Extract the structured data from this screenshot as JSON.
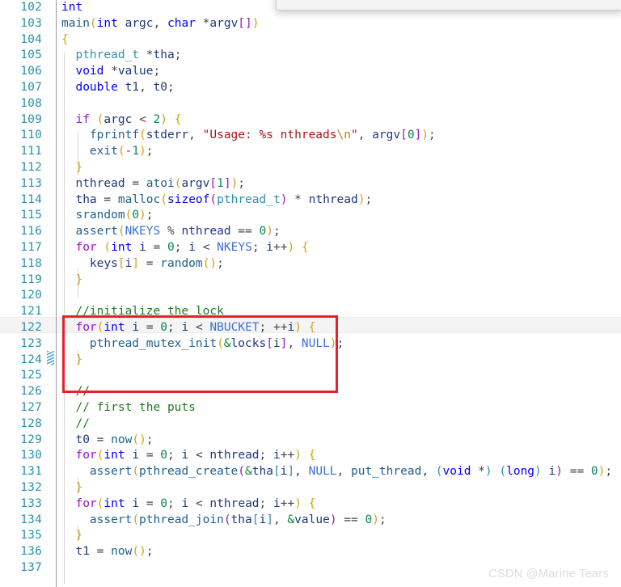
{
  "app": {
    "kind": "code-editor",
    "language": "C",
    "watermark": "CSDN @Marine Tears"
  },
  "popup": {
    "present": true,
    "label": ""
  },
  "gutter": {
    "first_line": 102,
    "last_line": 137,
    "change_marker_line": 123
  },
  "annotation": {
    "type": "red-rectangle",
    "covers_lines": [
      121,
      122,
      123,
      124
    ],
    "color": "#e8202a"
  },
  "highlight": {
    "current_line": 121,
    "color": "#f4f4f4"
  },
  "colors": {
    "line_number": "#2b91af",
    "keyword_control": "#9b17c4",
    "keyword_type": "#0000ff",
    "type_name": "#2b91af",
    "identifier": "#1f377f",
    "function": "#1f5f8f",
    "macro": "#3d6fd6",
    "number": "#098658",
    "string": "#a31515",
    "comment": "#1f7a1f",
    "bracket_gold": "#d4a017",
    "watermark": "#dcdcdc"
  },
  "code": {
    "lines": [
      {
        "n": 102,
        "text": "int"
      },
      {
        "n": 103,
        "text": "main(int argc, char *argv[])"
      },
      {
        "n": 104,
        "text": "{"
      },
      {
        "n": 105,
        "text": "  pthread_t *tha;"
      },
      {
        "n": 106,
        "text": "  void *value;"
      },
      {
        "n": 107,
        "text": "  double t1, t0;"
      },
      {
        "n": 108,
        "text": ""
      },
      {
        "n": 109,
        "text": "  if (argc < 2) {"
      },
      {
        "n": 110,
        "text": "    fprintf(stderr, \"Usage: %s nthreads\\n\", argv[0]);"
      },
      {
        "n": 111,
        "text": "    exit(-1);"
      },
      {
        "n": 112,
        "text": "  }"
      },
      {
        "n": 113,
        "text": "  nthread = atoi(argv[1]);"
      },
      {
        "n": 114,
        "text": "  tha = malloc(sizeof(pthread_t) * nthread);"
      },
      {
        "n": 115,
        "text": "  srandom(0);"
      },
      {
        "n": 116,
        "text": "  assert(NKEYS % nthread == 0);"
      },
      {
        "n": 117,
        "text": "  for (int i = 0; i < NKEYS; i++) {"
      },
      {
        "n": 118,
        "text": "    keys[i] = random();"
      },
      {
        "n": 119,
        "text": "  }"
      },
      {
        "n": 120,
        "text": ""
      },
      {
        "n": 121,
        "text": "  //initialize the lock"
      },
      {
        "n": 122,
        "text": "  for(int i = 0; i < NBUCKET; ++i) {"
      },
      {
        "n": 123,
        "text": "    pthread_mutex_init(&locks[i], NULL);"
      },
      {
        "n": 124,
        "text": "  }"
      },
      {
        "n": 125,
        "text": ""
      },
      {
        "n": 126,
        "text": "  //"
      },
      {
        "n": 127,
        "text": "  // first the puts"
      },
      {
        "n": 128,
        "text": "  //"
      },
      {
        "n": 129,
        "text": "  t0 = now();"
      },
      {
        "n": 130,
        "text": "  for(int i = 0; i < nthread; i++) {"
      },
      {
        "n": 131,
        "text": "    assert(pthread_create(&tha[i], NULL, put_thread, (void *) (long) i) == 0);"
      },
      {
        "n": 132,
        "text": "  }"
      },
      {
        "n": 133,
        "text": "  for(int i = 0; i < nthread; i++) {"
      },
      {
        "n": 134,
        "text": "    assert(pthread_join(tha[i], &value) == 0);"
      },
      {
        "n": 135,
        "text": "  }"
      },
      {
        "n": 136,
        "text": "  t1 = now();"
      },
      {
        "n": 137,
        "text": ""
      }
    ]
  }
}
